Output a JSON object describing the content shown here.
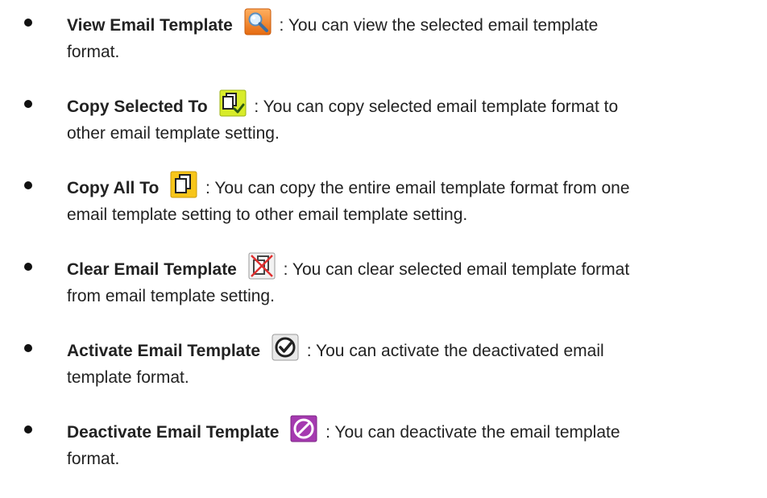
{
  "items": [
    {
      "name": "View Email Template",
      "icon": "view-template-icon",
      "sep": ":",
      "line1": "You can view the selected email template",
      "line2": "format."
    },
    {
      "name": "Copy Selected To",
      "icon": "copy-selected-icon",
      "sep": ":",
      "line1": "You can copy selected email template format to",
      "line2": "other email template setting."
    },
    {
      "name": "Copy All To",
      "icon": "copy-all-icon",
      "sep": ":",
      "line1": "You can copy the entire email template format from one",
      "line2": "email template setting to other email template setting."
    },
    {
      "name": "Clear Email Template",
      "icon": "clear-template-icon",
      "sep": ":",
      "line1": "You can clear selected email template format",
      "line2": "from email template setting."
    },
    {
      "name": "Activate Email Template",
      "icon": "activate-template-icon",
      "sep": ":",
      "line1": "You can activate the deactivated email",
      "line2": "template format."
    },
    {
      "name": "Deactivate Email Template",
      "icon": "deactivate-template-icon",
      "sep": ":",
      "line1": "You can deactivate the email template",
      "line2": "format."
    }
  ],
  "colors": {
    "view_icon_bg": "#f07a1e",
    "copy_selected_icon_bg": "#d8ec2a",
    "copy_all_icon_bg": "#f7c51a",
    "deactivate_icon_bg": "#a53ab0"
  }
}
